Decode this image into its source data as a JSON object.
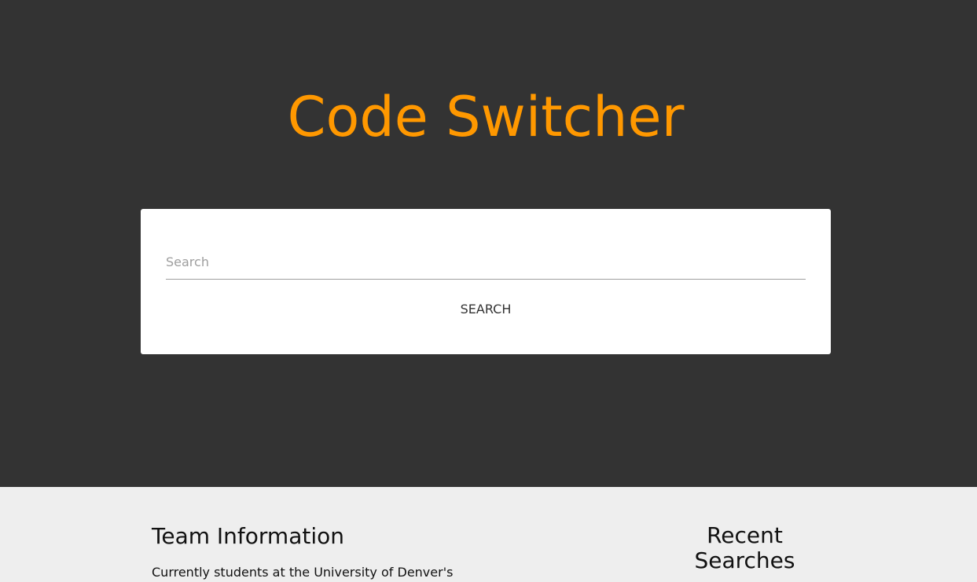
{
  "header": {
    "title": "Code Switcher"
  },
  "search": {
    "placeholder": "Search",
    "value": "",
    "button_label": "SEARCH"
  },
  "footer": {
    "team_heading": "Team Information",
    "team_text": "Currently students at the University of Denver's",
    "recent_heading": "Recent Searches"
  },
  "colors": {
    "hero_background": "#333333",
    "title_accent": "#ff9800",
    "footer_background": "#eeeeee"
  }
}
